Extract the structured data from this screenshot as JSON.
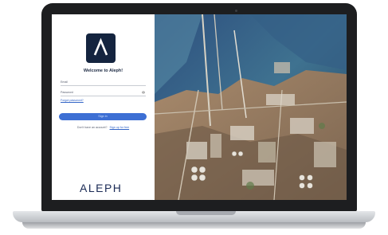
{
  "login": {
    "logo_glyph": "Λ",
    "welcome": "Welcome to Aleph!",
    "email_placeholder": "Email",
    "password_placeholder": "Password",
    "forgot_password": "Forgot password?",
    "sign_in": "Sign in",
    "no_account": "Don't have an account?",
    "sign_up": "Sign up for free",
    "wordmark": "ALEPH"
  },
  "colors": {
    "brand_navy": "#14243f",
    "primary_button": "#3d6fd4",
    "link": "#3164c6"
  },
  "icons": [
    "eye-icon",
    "aleph-logo-icon"
  ]
}
